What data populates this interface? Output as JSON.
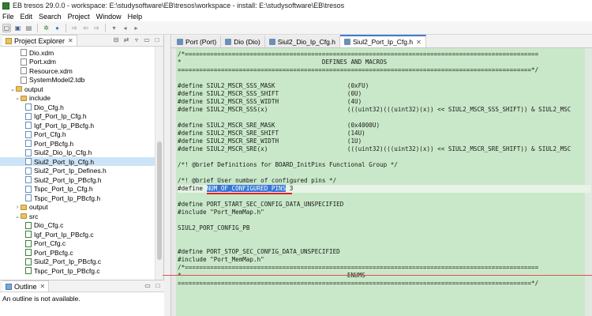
{
  "window": {
    "title": "EB tresos 29.0.0 - workspace: E:\\studysoftware\\EB\\tresos\\workspace - install: E:\\studysoftware\\EB\\tresos"
  },
  "menu": [
    "File",
    "Edit",
    "Search",
    "Project",
    "Window",
    "Help"
  ],
  "toolbar_icons": [
    "new-icon",
    "save-icon",
    "print-icon",
    "gear-icon",
    "run-icon",
    "forward-icon",
    "back-icon",
    "forward-icon"
  ],
  "left_panel": {
    "tab_label": "Project Explorer",
    "tree": [
      {
        "label": "Dio.xdm",
        "indent": 3,
        "type": "file-x",
        "twist": ""
      },
      {
        "label": "Port.xdm",
        "indent": 3,
        "type": "file-x",
        "twist": ""
      },
      {
        "label": "Resource.xdm",
        "indent": 3,
        "type": "file-x",
        "twist": ""
      },
      {
        "label": "SystemModel2.tdb",
        "indent": 3,
        "type": "file-x",
        "twist": ""
      },
      {
        "label": "output",
        "indent": 2,
        "type": "folder",
        "twist": "v"
      },
      {
        "label": "include",
        "indent": 3,
        "type": "folder",
        "twist": "v"
      },
      {
        "label": "Dio_Cfg.h",
        "indent": 4,
        "type": "file-h",
        "twist": ""
      },
      {
        "label": "Igf_Port_Ip_Cfg.h",
        "indent": 4,
        "type": "file-h",
        "twist": ""
      },
      {
        "label": "Igf_Port_Ip_PBcfg.h",
        "indent": 4,
        "type": "file-h",
        "twist": ""
      },
      {
        "label": "Port_Cfg.h",
        "indent": 4,
        "type": "file-h",
        "twist": ""
      },
      {
        "label": "Port_PBcfg.h",
        "indent": 4,
        "type": "file-h",
        "twist": ""
      },
      {
        "label": "Siul2_Dio_Ip_Cfg.h",
        "indent": 4,
        "type": "file-h",
        "twist": ""
      },
      {
        "label": "Siul2_Port_Ip_Cfg.h",
        "indent": 4,
        "type": "file-h",
        "twist": "",
        "selected": true
      },
      {
        "label": "Siul2_Port_Ip_Defines.h",
        "indent": 4,
        "type": "file-h",
        "twist": ""
      },
      {
        "label": "Siul2_Port_Ip_PBcfg.h",
        "indent": 4,
        "type": "file-h",
        "twist": ""
      },
      {
        "label": "Tspc_Port_Ip_Cfg.h",
        "indent": 4,
        "type": "file-h",
        "twist": ""
      },
      {
        "label": "Tspc_Port_Ip_PBcfg.h",
        "indent": 4,
        "type": "file-h",
        "twist": ""
      },
      {
        "label": "output",
        "indent": 3,
        "type": "folder",
        "twist": ">"
      },
      {
        "label": "src",
        "indent": 3,
        "type": "folder",
        "twist": "v"
      },
      {
        "label": "Dio_Cfg.c",
        "indent": 4,
        "type": "file-c",
        "twist": ""
      },
      {
        "label": "Igf_Port_Ip_PBcfg.c",
        "indent": 4,
        "type": "file-c",
        "twist": ""
      },
      {
        "label": "Port_Cfg.c",
        "indent": 4,
        "type": "file-c",
        "twist": ""
      },
      {
        "label": "Port_PBcfg.c",
        "indent": 4,
        "type": "file-c",
        "twist": ""
      },
      {
        "label": "Siul2_Port_Ip_PBcfg.c",
        "indent": 4,
        "type": "file-c",
        "twist": ""
      },
      {
        "label": "Tspc_Port_Ip_PBcfg.c",
        "indent": 4,
        "type": "file-c",
        "twist": ""
      }
    ]
  },
  "outline": {
    "tab_label": "Outline",
    "message": "An outline is not available."
  },
  "editor": {
    "tabs": [
      {
        "label": "Port (Port)",
        "active": false
      },
      {
        "label": "Dio (Dio)",
        "active": false
      },
      {
        "label": "Siul2_Dio_Ip_Cfg.h",
        "active": false
      },
      {
        "label": "Siul2_Port_Ip_Cfg.h",
        "active": true
      }
    ],
    "lines": [
      "/*==================================================================================================",
      "*                                       DEFINES AND MACROS",
      "==================================================================================================*/",
      "",
      "#define SIUL2_MSCR_SSS_MASK                    (0xFU)",
      "#define SIUL2_MSCR_SSS_SHIFT                   (0U)",
      "#define SIUL2_MSCR_SSS_WIDTH                   (4U)",
      "#define SIUL2_MSCR_SSS(x)                      (((uint32)(((uint32)(x)) << SIUL2_MSCR_SSS_SHIFT)) & SIUL2_MSC",
      "",
      "#define SIUL2_MSCR_SRE_MASK                    (0x4000U)",
      "#define SIUL2_MSCR_SRE_SHIFT                   (14U)",
      "#define SIUL2_MSCR_SRE_WIDTH                   (1U)",
      "#define SIUL2_MSCR_SRE(x)                      (((uint32)(((uint32)(x)) << SIUL2_MSCR_SRE_SHIFT)) & SIUL2_MSC",
      "",
      "/*! @brief Definitions for BOARD_InitPins Functional Group */",
      "",
      "/*! @brief User number of configured pins */",
      "",
      "",
      "#define PORT_START_SEC_CONFIG_DATA_UNSPECIFIED",
      "#include \"Port_MemMap.h\"",
      "",
      "SIUL2_PORT_CONFIG_PB",
      "",
      "",
      "#define PORT_STOP_SEC_CONFIG_DATA_UNSPECIFIED",
      "#include \"Port_MemMap.h\"",
      "/*==================================================================================================",
      "*                                              ENUMS",
      "==================================================================================================*/"
    ],
    "current_line": {
      "prefix": "#define ",
      "selected": "NUM_OF_CONFIGURED_PINS",
      "suffix": " 3"
    }
  }
}
